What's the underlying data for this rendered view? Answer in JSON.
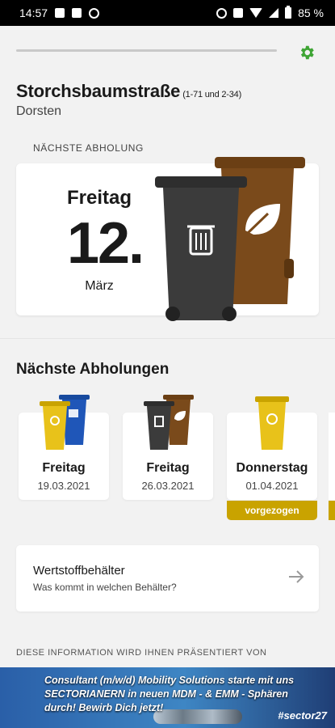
{
  "status_bar": {
    "time": "14:57",
    "battery": "85 %"
  },
  "header": {
    "street": "Storchsbaumstraße",
    "range": "(1-71 und 2-34)",
    "city": "Dorsten",
    "next_label": "NÄCHSTE ABHOLUNG"
  },
  "next_pickup": {
    "day": "Freitag",
    "date": "12.",
    "month": "März"
  },
  "upcoming": {
    "title": "Nächste Abholungen",
    "items": [
      {
        "day": "Freitag",
        "date": "19.03.2021"
      },
      {
        "day": "Freitag",
        "date": "26.03.2021"
      },
      {
        "day": "Donnerstag",
        "date": "01.04.2021",
        "badge": "vorgezogen"
      }
    ]
  },
  "info": {
    "title": "Wertstoffbehälter",
    "subtitle": "Was kommt in welchen Behälter?"
  },
  "presented_by": "DIESE INFORMATION WIRD IHNEN PRÄSENTIERT VON",
  "banner": {
    "text": "Consultant (m/w/d) Mobility Solutions starte mit uns SECTORIANERN in neuen MDM - & EMM - Sphären durch! Bewirb Dich jetzt!",
    "brand": "#sector27"
  },
  "colors": {
    "accent": "#3fa535",
    "yellow_bin": "#e8c21a",
    "blue_bin": "#1f56b8",
    "brown_bin": "#7a4a1b",
    "grey_bin": "#3b3b3b",
    "badge": "#c9a300"
  },
  "icons": [
    "alarm-icon",
    "nfc-icon",
    "wifi-icon",
    "signal-icon",
    "battery-icon",
    "gear-icon",
    "trash-icon",
    "leaf-icon",
    "recycle-icon",
    "arrow-right-icon"
  ]
}
